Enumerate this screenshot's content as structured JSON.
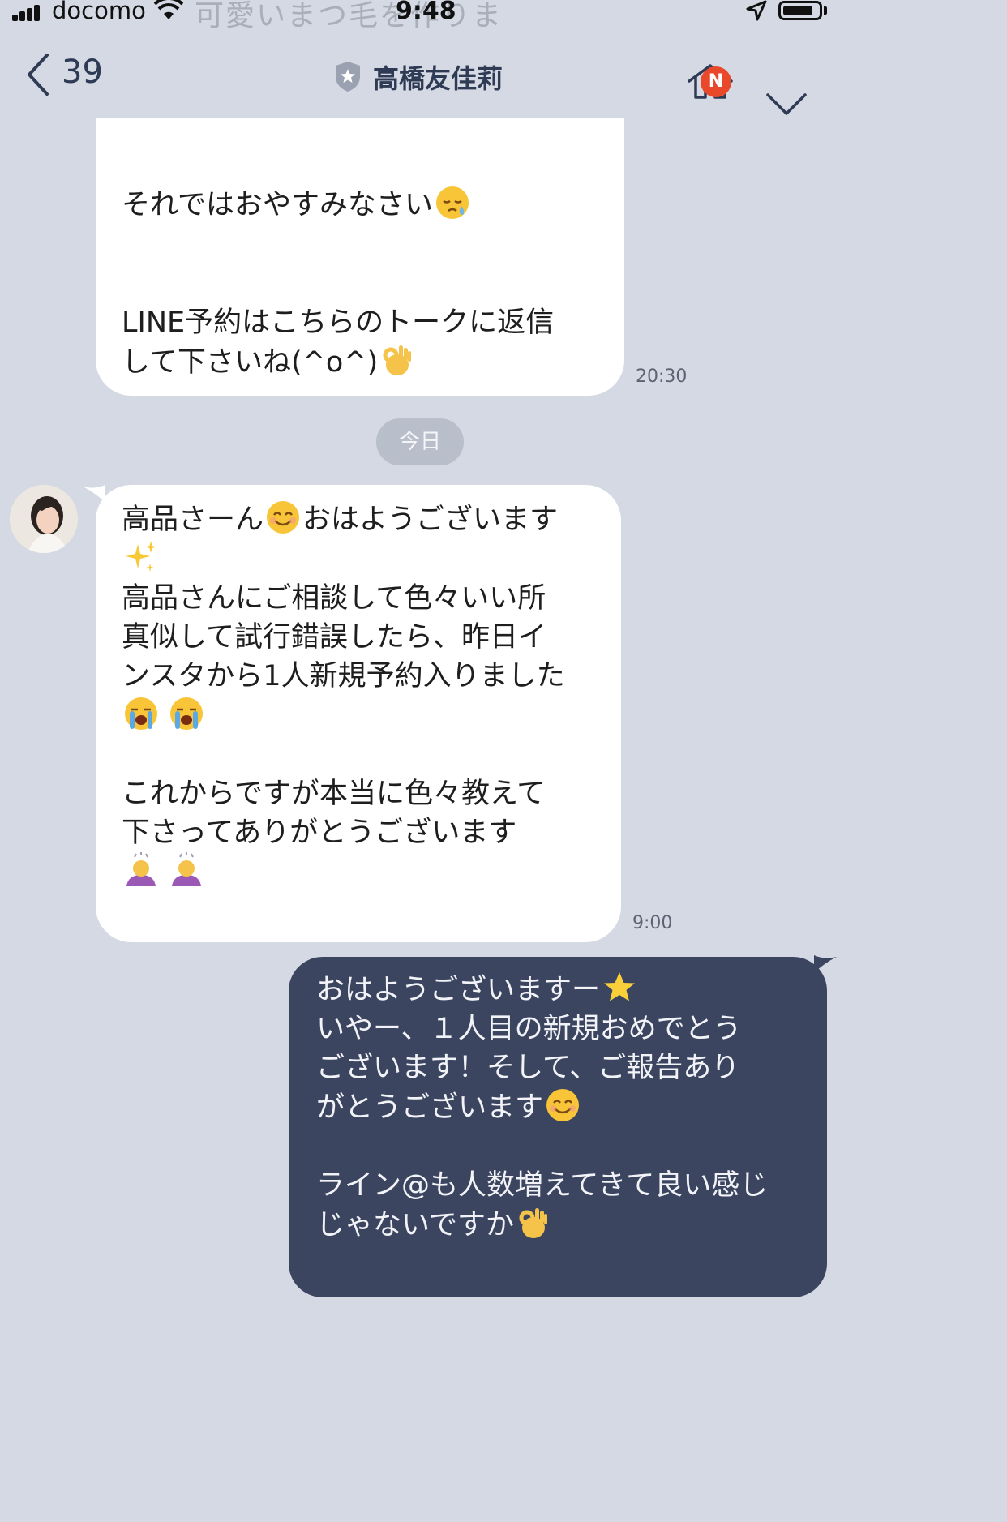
{
  "status_bar": {
    "carrier": "docomo",
    "time": "9:48",
    "ghost_text": "可愛いまつ毛を作りま"
  },
  "header": {
    "back_count": "39",
    "title": "高橋友佳莉",
    "home_badge": "N",
    "icons": [
      "back-chevron-icon",
      "shield-icon",
      "home-icon",
      "chevron-down-icon"
    ]
  },
  "messages": [
    {
      "side": "left",
      "line1": "それではおやすみなさい",
      "line1_emoji": "sleepy-face",
      "text": "LINE予約はこちらのトークに返信\nして下さいね(^o^)",
      "end_emoji": "ok-hand",
      "time": "20:30"
    },
    {
      "side": "left",
      "p1": "高品さーん",
      "p1b": "おはようございます",
      "p2": "高品さんにご相談して色々いい所\n真似して試行錯誤したら、昨日イ\nンスタから1人新規予約入りました",
      "p3": "これからですが本当に色々教えて\n下さってありがとうございます",
      "time": "9:00"
    },
    {
      "side": "right",
      "l1": "おはようございますー",
      "l2": "いやー、１人目の新規おめでとう\nございます！そして、ご報告あり\nがとうございます",
      "l3": "ライン@も人数増えてきて良い感じ\nじゃないですか"
    }
  ],
  "date_separator": "今日",
  "colors": {
    "background": "#d4d9e3",
    "bubble_received": "#ffffff",
    "bubble_sent": "#3b4560",
    "badge": "#e9482a",
    "header_text": "#2f3b55"
  }
}
